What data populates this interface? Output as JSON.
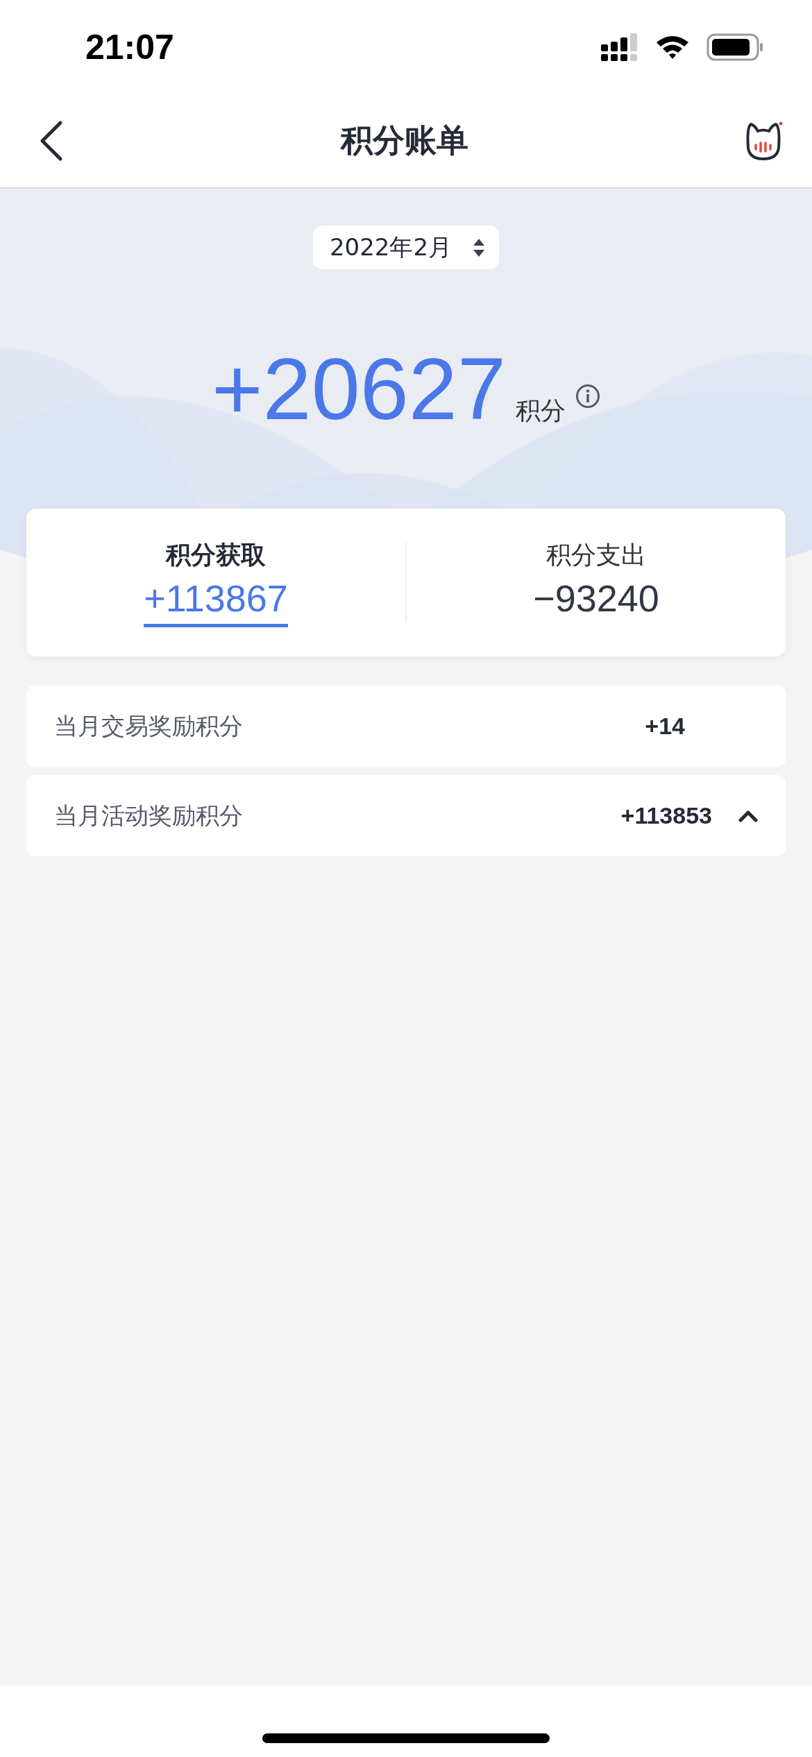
{
  "status_bar": {
    "time": "21:07"
  },
  "nav": {
    "title": "积分账单"
  },
  "month_picker": {
    "value": "2022年2月"
  },
  "summary": {
    "total": "+20627",
    "unit": "积分"
  },
  "tabs": [
    {
      "label": "积分获取",
      "value": "+113867",
      "selected": true
    },
    {
      "label": "积分支出",
      "value": "−93240",
      "selected": false
    }
  ],
  "rows": [
    {
      "kind": "plain",
      "label": "当月交易奖励积分",
      "value": "+14"
    },
    {
      "kind": "expandable",
      "label": "当月活动奖励积分",
      "value": "+113853",
      "expanded": true
    }
  ]
}
